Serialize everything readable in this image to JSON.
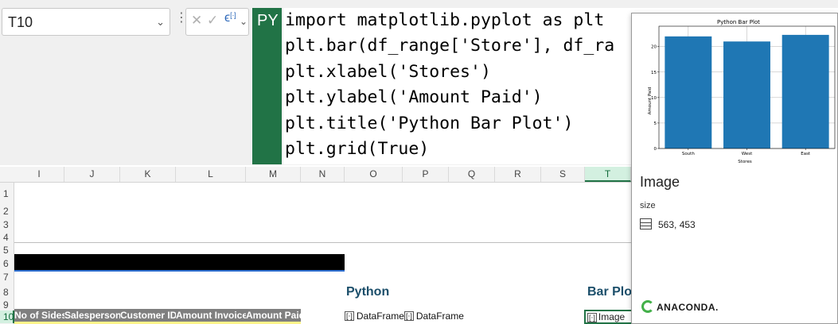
{
  "namebox": {
    "value": "T10"
  },
  "formula": {
    "py_badge": "PY",
    "code_lines": [
      "import matplotlib.pyplot as plt",
      "plt.bar(df_range['Store'], df_ra",
      "plt.xlabel('Stores')",
      "plt.ylabel('Amount Paid')",
      "plt.title('Python Bar Plot')",
      "plt.grid(True)"
    ]
  },
  "grid": {
    "columns": [
      "I",
      "J",
      "K",
      "L",
      "M",
      "N",
      "O",
      "P",
      "Q",
      "R",
      "S",
      "T"
    ],
    "selected_column": "T",
    "rows": [
      "1",
      "2",
      "3",
      "4",
      "5",
      "6",
      "7",
      "8",
      "9",
      "10"
    ],
    "selected_row": "10"
  },
  "sheet": {
    "python_heading": "Python",
    "barplot_heading": "Bar Plo",
    "table_headers": [
      "No of Sides",
      "Salesperson",
      "Customer ID",
      "Amount Invoiced",
      "Amount Paid"
    ],
    "dataframe_cells": [
      "DataFrame",
      "DataFrame"
    ],
    "image_cell": "Image"
  },
  "preview": {
    "type_title": "Image",
    "size_label": "size",
    "size_value": "563, 453",
    "brand": "ANACONDA."
  },
  "colors": {
    "excel_green": "#217346",
    "bar_blue": "#1f77b4",
    "header_gray": "#7f7f7f",
    "heading_teal": "#1b4e6a"
  },
  "chart_data": {
    "type": "bar",
    "title": "Python Bar Plot",
    "xlabel": "Stores",
    "ylabel": "Amount Paid",
    "categories": [
      "South",
      "West",
      "East"
    ],
    "values": [
      22.0,
      21.0,
      22.3
    ],
    "ylim": [
      0,
      24
    ],
    "yticks": [
      0,
      5,
      10,
      15,
      20
    ],
    "grid": true
  }
}
